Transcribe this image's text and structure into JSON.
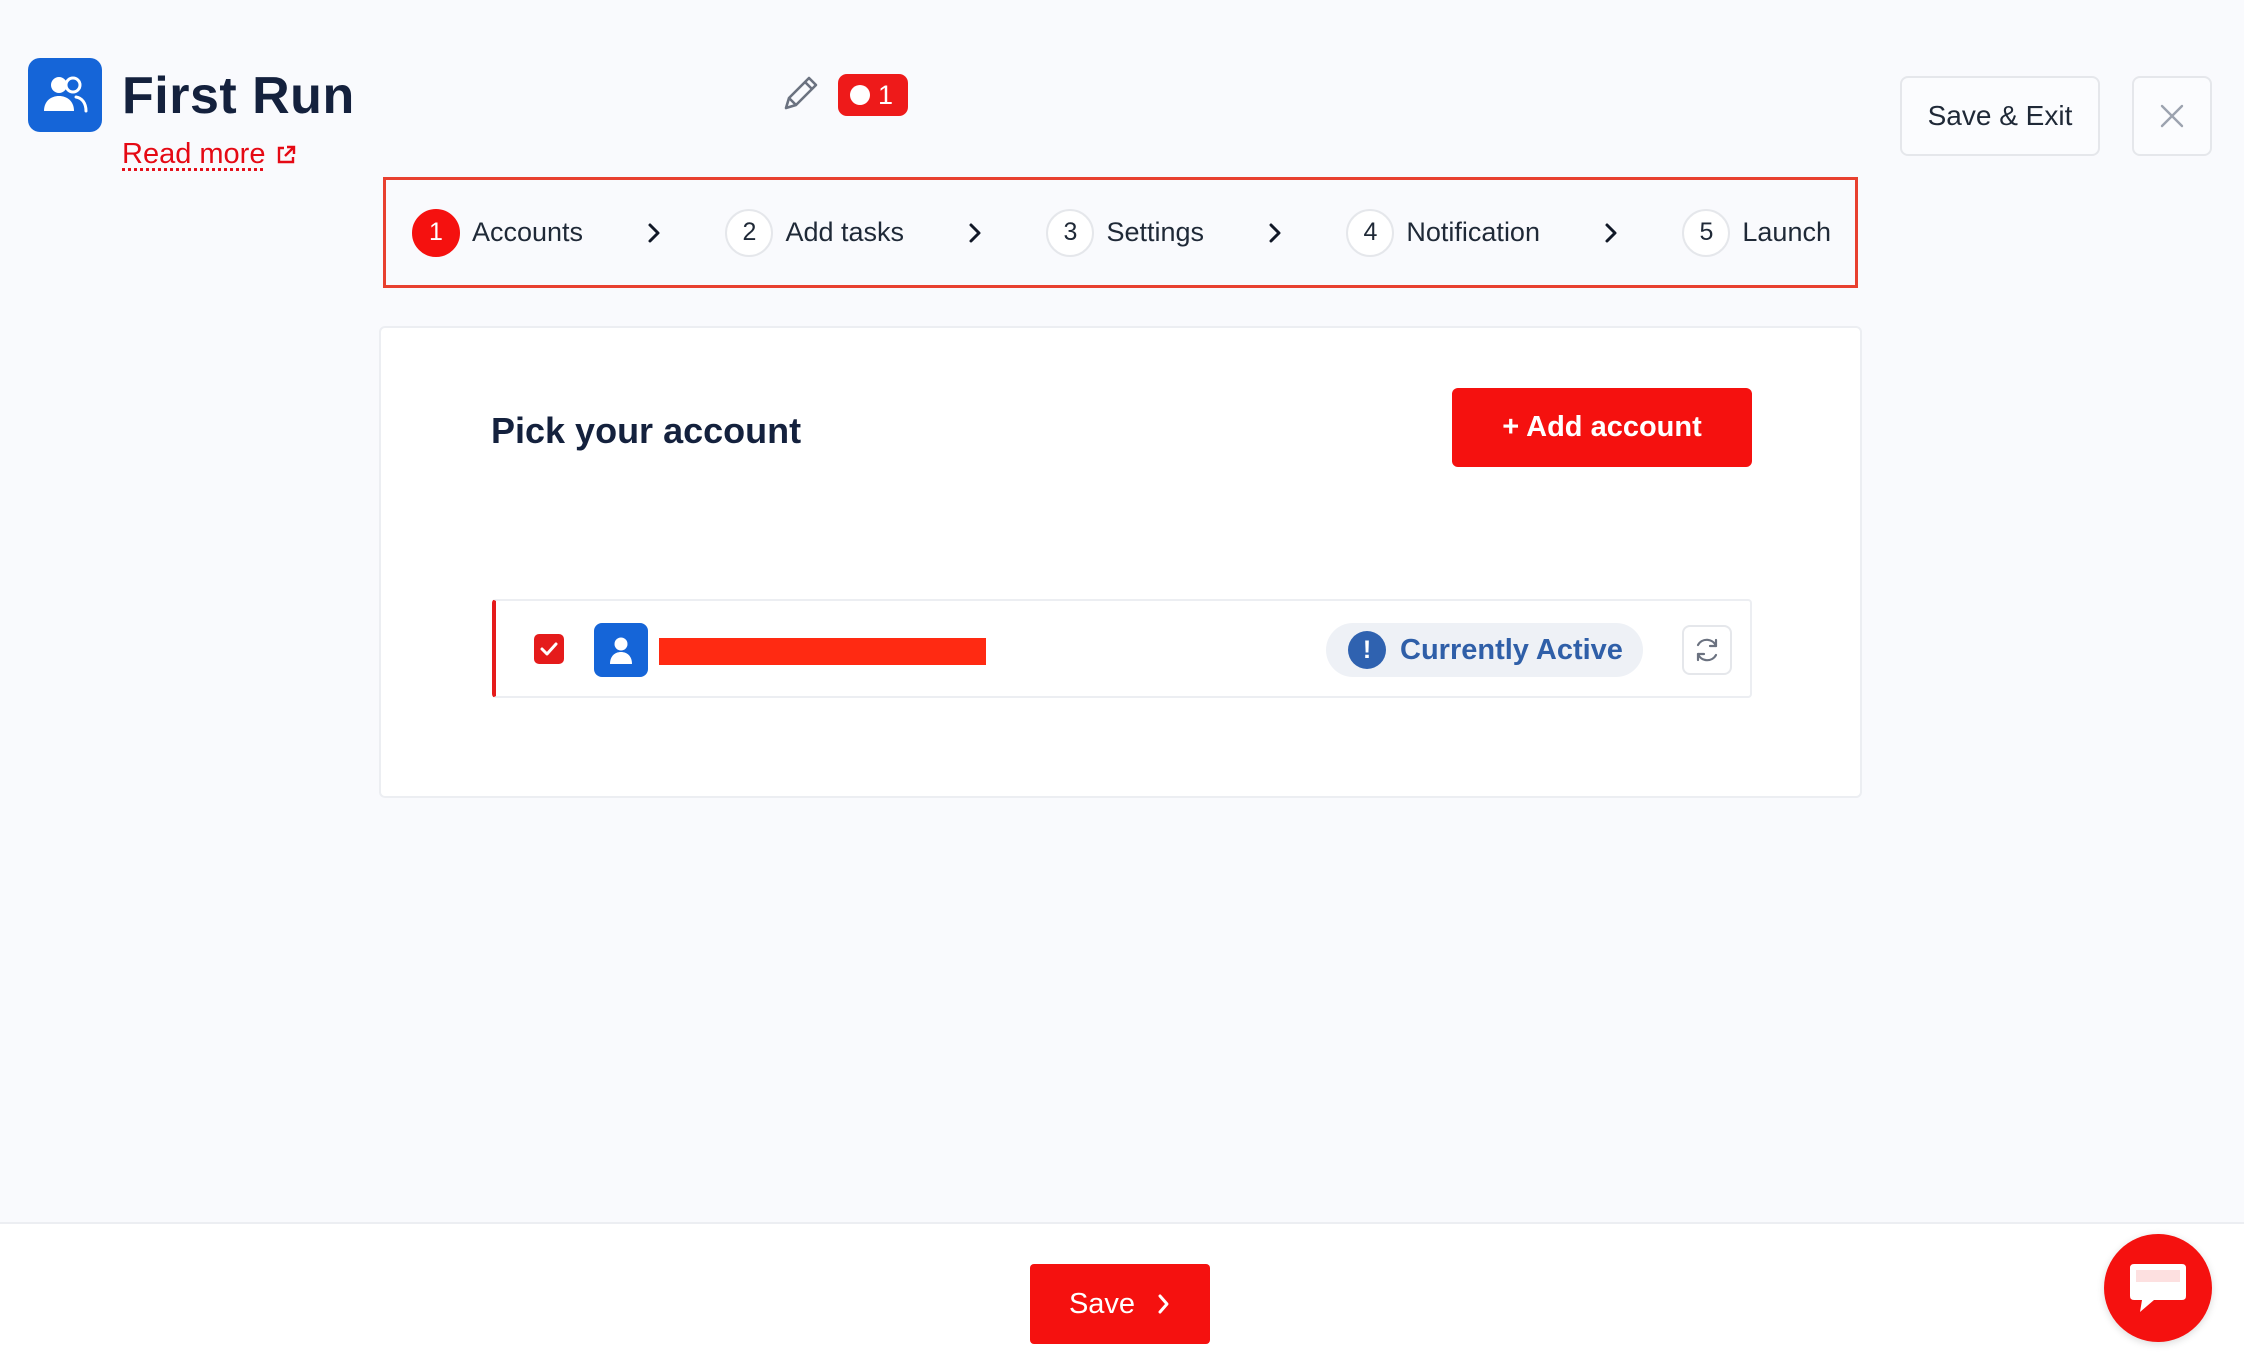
{
  "header": {
    "title": "First Run",
    "read_more": "Read more",
    "task_count": "1",
    "save_exit": "Save & Exit"
  },
  "stepper": {
    "steps": [
      {
        "num": "1",
        "label": "Accounts",
        "active": true
      },
      {
        "num": "2",
        "label": "Add tasks"
      },
      {
        "num": "3",
        "label": "Settings"
      },
      {
        "num": "4",
        "label": "Notification"
      },
      {
        "num": "5",
        "label": "Launch"
      }
    ]
  },
  "card": {
    "title": "Pick your account",
    "add_account": "+ Add account",
    "account": {
      "checked": true,
      "status": "Currently Active",
      "status_icon": "!"
    }
  },
  "footer": {
    "save": "Save"
  },
  "colors": {
    "accent": "#f5110f",
    "brand_blue": "#1565d8",
    "status_text": "#2f5fa8"
  }
}
